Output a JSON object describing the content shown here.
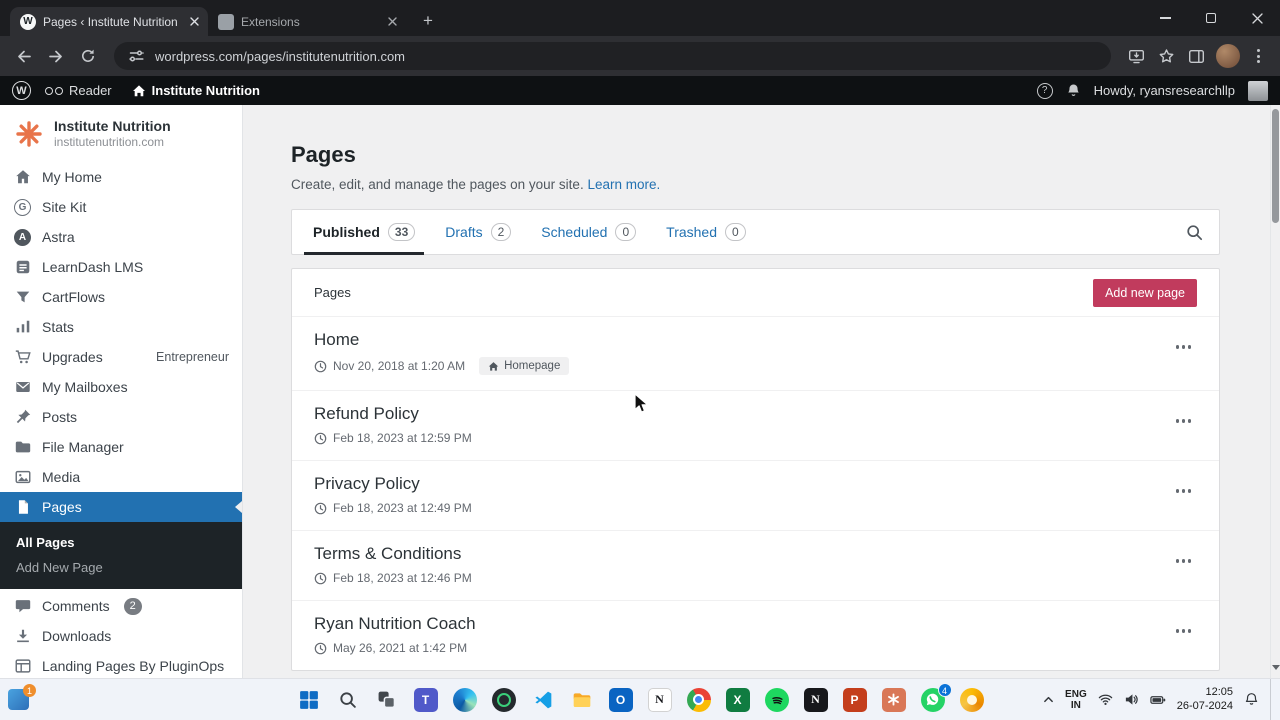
{
  "browser": {
    "tabs": [
      {
        "title": "Pages ‹ Institute Nutrition — W"
      },
      {
        "title": "Extensions"
      }
    ],
    "url": "wordpress.com/pages/institutenutrition.com"
  },
  "admin_bar": {
    "reader_label": "Reader",
    "site_label": "Institute Nutrition",
    "howdy": "Howdy, ryansresearchllp"
  },
  "sidebar": {
    "site": {
      "name": "Institute Nutrition",
      "domain": "institutenutrition.com"
    },
    "items": [
      {
        "label": "My Home",
        "icon": "home-icon"
      },
      {
        "label": "Site Kit",
        "icon": "sitekit-icon"
      },
      {
        "label": "Astra",
        "icon": "astra-icon"
      },
      {
        "label": "LearnDash LMS",
        "icon": "learndash-icon"
      },
      {
        "label": "CartFlows",
        "icon": "cartflows-icon"
      },
      {
        "label": "Stats",
        "icon": "stats-icon"
      },
      {
        "label": "Upgrades",
        "icon": "upgrades-icon",
        "badge": "Entrepreneur"
      },
      {
        "label": "My Mailboxes",
        "icon": "mailbox-icon"
      },
      {
        "label": "Posts",
        "icon": "posts-icon"
      },
      {
        "label": "File Manager",
        "icon": "folder-icon"
      },
      {
        "label": "Media",
        "icon": "media-icon"
      },
      {
        "label": "Pages",
        "icon": "pages-icon",
        "active": true
      },
      {
        "label": "Comments",
        "icon": "comments-icon",
        "count": "2"
      },
      {
        "label": "Downloads",
        "icon": "downloads-icon"
      },
      {
        "label": "Landing Pages By PluginOps",
        "icon": "layout-icon"
      }
    ],
    "submenu": [
      "All Pages",
      "Add New Page"
    ]
  },
  "main": {
    "title": "Pages",
    "subtitle": "Create, edit, and manage the pages on your site.",
    "learn_more": "Learn more.",
    "tabs": [
      {
        "label": "Published",
        "count": "33",
        "active": true
      },
      {
        "label": "Drafts",
        "count": "2"
      },
      {
        "label": "Scheduled",
        "count": "0"
      },
      {
        "label": "Trashed",
        "count": "0"
      }
    ],
    "list": {
      "header": "Pages",
      "add_button": "Add new page",
      "rows": [
        {
          "title": "Home",
          "date": "Nov 20, 2018 at 1:20 AM",
          "badge": "Homepage"
        },
        {
          "title": "Refund Policy",
          "date": "Feb 18, 2023 at 12:59 PM"
        },
        {
          "title": "Privacy Policy",
          "date": "Feb 18, 2023 at 12:49 PM"
        },
        {
          "title": "Terms & Conditions",
          "date": "Feb 18, 2023 at 12:46 PM"
        },
        {
          "title": "Ryan Nutrition Coach",
          "date": "May 26, 2021 at 1:42 PM"
        }
      ]
    }
  },
  "taskbar": {
    "tray": {
      "lang_line1": "ENG",
      "lang_line2": "IN",
      "time": "12:05",
      "date": "26-07-2024"
    },
    "whatsapp_badge": "4",
    "corner_badge": "1"
  },
  "icon_glyphs": {
    "wordpress": "W",
    "plus": "+",
    "sitekit": "G",
    "astra": "A",
    "help": "?",
    "teams": "T",
    "outlook": "O",
    "notion": "N",
    "notion2": "N",
    "excel": "X",
    "powerpoint": "P"
  },
  "colors": {
    "accent_button": "#c13b5d",
    "active_menu": "#2271b1",
    "link_blue": "#2271b1",
    "admin_bar_bg": "#0e1113",
    "taskbar_bg": "#f0f3f9"
  }
}
